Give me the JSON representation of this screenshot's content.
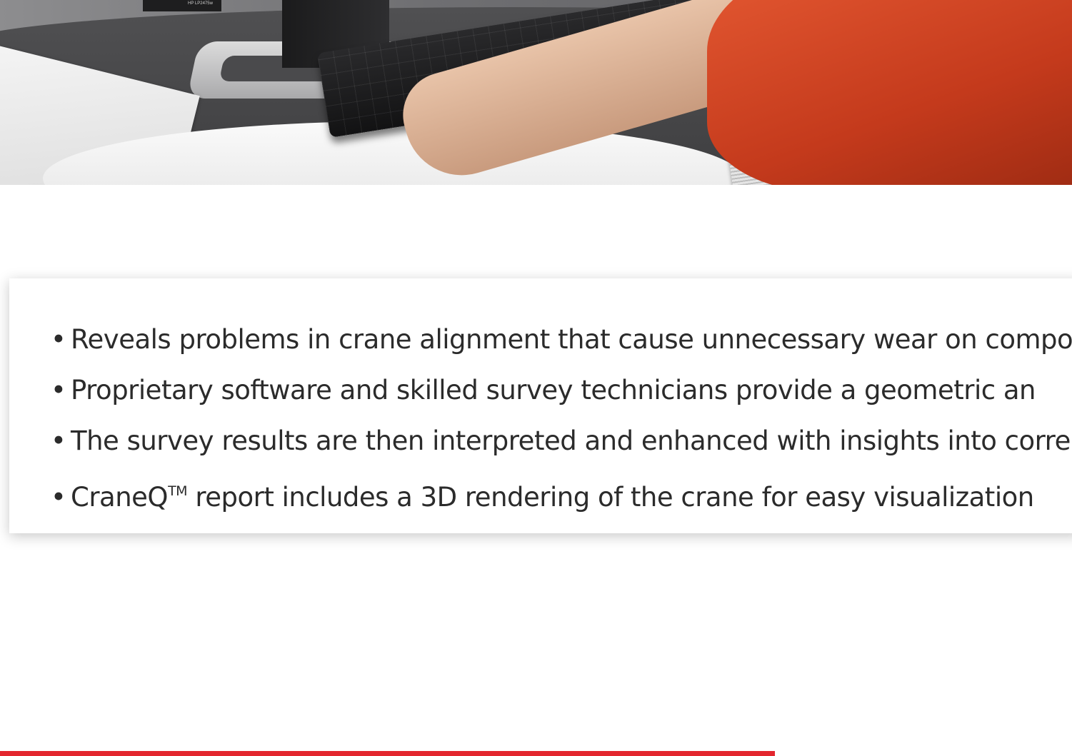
{
  "hero": {
    "monitor_label": "HP LP2475w"
  },
  "features": {
    "bullet_symbol": "•",
    "items": [
      {
        "text": "Reveals problems in crane alignment that cause unnecessary wear on compo"
      },
      {
        "text": "Proprietary software and skilled survey technicians provide a geometric an"
      },
      {
        "text": "The survey results are then interpreted and enhanced with insights into corre"
      },
      {
        "pre": "CraneQ",
        "tm": "TM",
        "text": " report includes a 3D rendering of the crane for easy visualization"
      }
    ]
  },
  "colors": {
    "accent": "#e3262e",
    "text": "#2b2b2b"
  }
}
